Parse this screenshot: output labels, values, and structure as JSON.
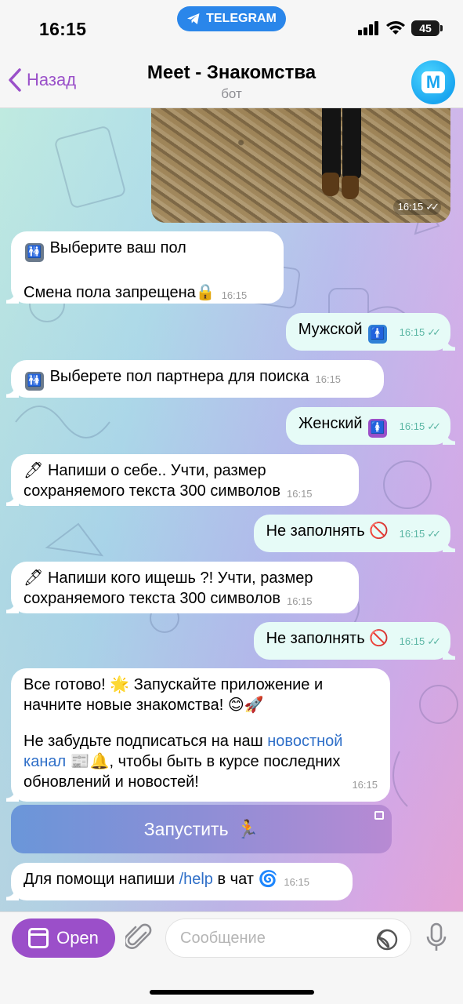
{
  "status_bar": {
    "time": "16:15",
    "pill_label": "TELEGRAM",
    "battery": "45"
  },
  "header": {
    "back_label": "Назад",
    "title": "Meet - Знакомства",
    "subtitle": "бот",
    "avatar_letter": "M"
  },
  "photo": {
    "time": "16:15"
  },
  "messages": [
    {
      "dir": "in",
      "lines": [
        "Выберите ваш пол",
        "",
        "Смена пола запрещена"
      ],
      "time": "16:15"
    },
    {
      "dir": "out",
      "text": "Мужской",
      "time": "16:15"
    },
    {
      "dir": "in",
      "text": "Выберете пол партнера для поиска",
      "time": "16:15"
    },
    {
      "dir": "out",
      "text": "Женский",
      "time": "16:15"
    },
    {
      "dir": "in",
      "lines": [
        "Напиши о себе.. Учти, размер",
        "сохраняемого текста 300 символов"
      ],
      "time": "16:15"
    },
    {
      "dir": "out",
      "text": "Не заполнять",
      "time": "16:15"
    },
    {
      "dir": "in",
      "lines": [
        "Напиши кого ищешь ?! Учти, размер",
        "сохраняемого текста 300 символов"
      ],
      "time": "16:15"
    },
    {
      "dir": "out",
      "text": "Не заполнять",
      "time": "16:15"
    },
    {
      "dir": "in",
      "line1": "Все готово!",
      "line1b": "Запускайте приложение и",
      "line2": "начните новые знакомства!",
      "line3a": "Не забудьте подписаться на наш",
      "link1": "новостной",
      "link2": "канал",
      "line4b": ", чтобы быть в курсе последних",
      "line5": "обновлений и новостей!",
      "time": "16:15"
    },
    {
      "dir": "in",
      "text_a": "Для помощи напиши",
      "cmd": "/help",
      "text_b": "в чат",
      "time": "16:15"
    }
  ],
  "launch_button": {
    "label": "Запустить"
  },
  "input_bar": {
    "open_label": "Open",
    "placeholder": "Сообщение"
  },
  "colors": {
    "accent": "#9b4fc9",
    "telegram_blue": "#2a86ea",
    "outgoing_bubble": "#e6fbf7",
    "link": "#2f6fc8"
  }
}
